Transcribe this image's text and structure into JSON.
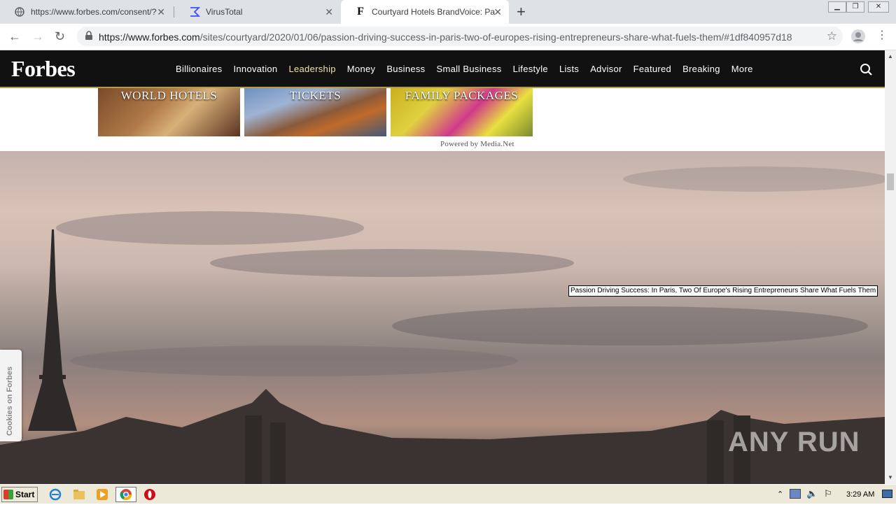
{
  "browser": {
    "tabs": [
      {
        "label": "https://www.forbes.com/consent/?t",
        "active": false
      },
      {
        "label": "VirusTotal",
        "active": false
      },
      {
        "label": "Courtyard Hotels BrandVoice: Passio",
        "active": true
      }
    ],
    "url_scheme_host": "https://www.forbes.com",
    "url_path": "/sites/courtyard/2020/01/06/passion-driving-success-in-paris-two-of-europes-rising-entrepreneurs-share-what-fuels-them/#1df840957d18"
  },
  "forbes": {
    "logo": "Forbes",
    "nav": [
      "Billionaires",
      "Innovation",
      "Leadership",
      "Money",
      "Business",
      "Small Business",
      "Lifestyle",
      "Lists",
      "Advisor",
      "Featured",
      "Breaking",
      "More"
    ],
    "active_nav": "Leadership"
  },
  "ads": {
    "tiles": [
      "WORLD HOTELS",
      "TICKETS",
      "FAMILY PACKAGES"
    ],
    "powered_by": "Powered by Media.Net"
  },
  "hero": {
    "tooltip": "Passion Driving Success: In Paris, Two Of Europe's Rising Entrepreneurs Share What Fuels Them",
    "cookies_tab": "Cookies on Forbes",
    "watermark": "ANY RUN"
  },
  "taskbar": {
    "start_label": "Start",
    "clock": "3:29 AM"
  },
  "colors": {
    "forbes_nav_bg": "#111111",
    "active_nav": "#f2e1a5",
    "accent_gold": "#b59a4a"
  }
}
